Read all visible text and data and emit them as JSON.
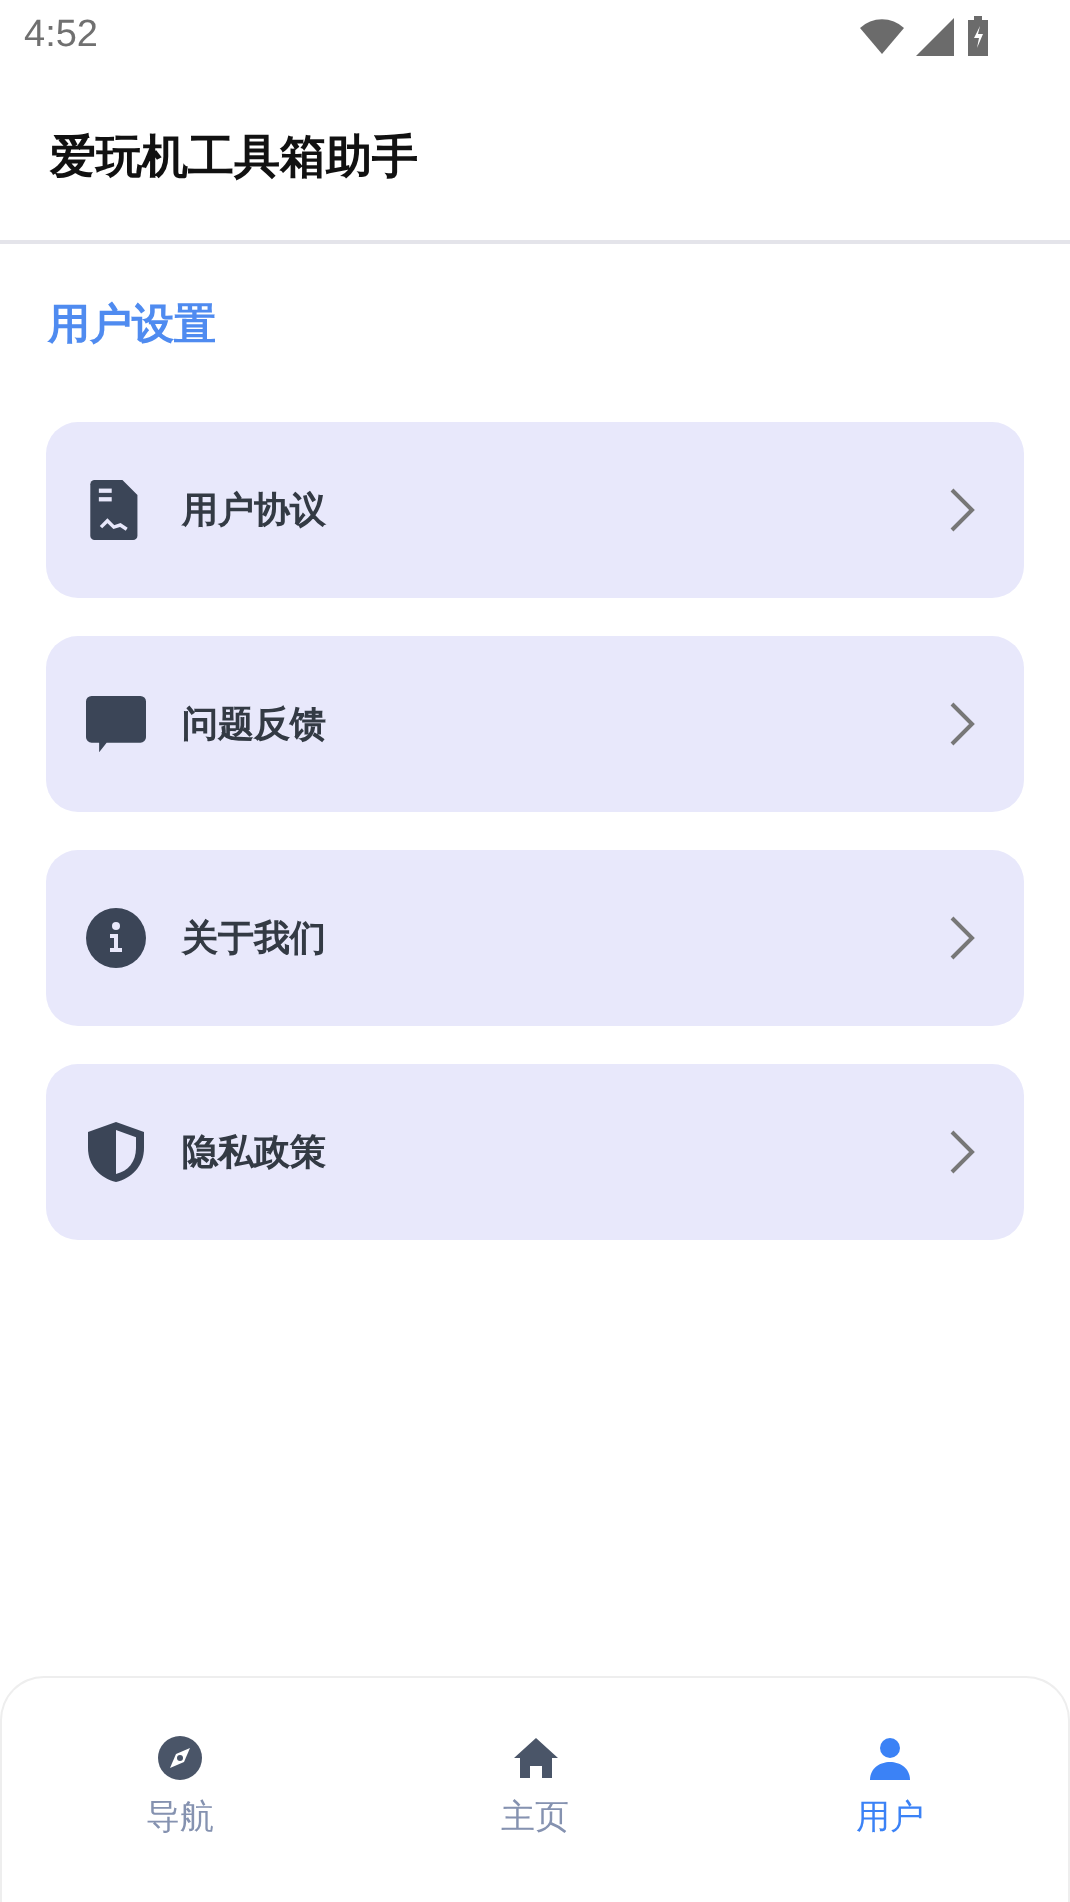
{
  "status_bar": {
    "time": "4:52"
  },
  "app_bar": {
    "title": "爱玩机工具箱助手"
  },
  "section": {
    "title": "用户设置"
  },
  "items": [
    {
      "kind": "document",
      "label": "用户协议"
    },
    {
      "kind": "chat",
      "label": "问题反馈"
    },
    {
      "kind": "info",
      "label": "关于我们"
    },
    {
      "kind": "shield",
      "label": "隐私政策"
    }
  ],
  "bottom_nav": [
    {
      "kind": "compass",
      "label": "导航",
      "selected": false
    },
    {
      "kind": "home",
      "label": "主页",
      "selected": false
    },
    {
      "kind": "user",
      "label": "用户",
      "selected": true
    }
  ]
}
